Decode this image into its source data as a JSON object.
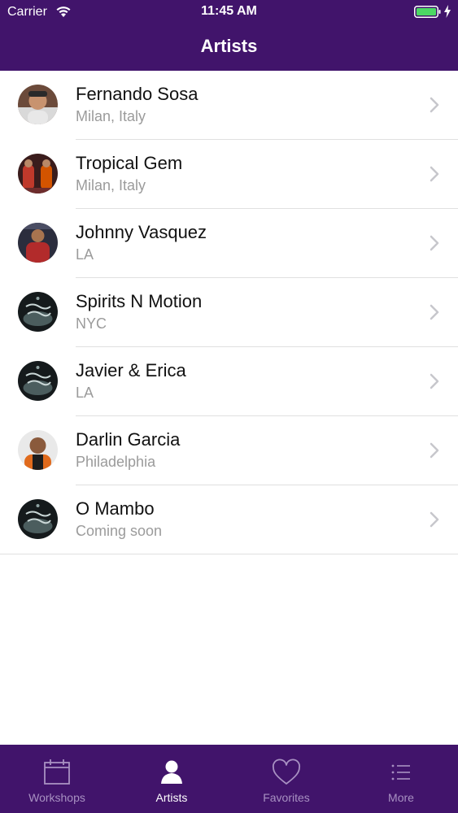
{
  "status_bar": {
    "carrier": "Carrier",
    "time": "11:45 AM"
  },
  "nav": {
    "title": "Artists"
  },
  "artists": [
    {
      "name": "Fernando Sosa",
      "location": "Milan, Italy",
      "avatar": "photo"
    },
    {
      "name": "Tropical Gem",
      "location": "Milan, Italy",
      "avatar": "photo"
    },
    {
      "name": "Johnny Vasquez",
      "location": "LA",
      "avatar": "photo"
    },
    {
      "name": "Spirits N Motion",
      "location": "NYC",
      "avatar": "coming-soon"
    },
    {
      "name": "Javier & Erica",
      "location": "LA",
      "avatar": "coming-soon"
    },
    {
      "name": "Darlin Garcia",
      "location": "Philadelphia",
      "avatar": "photo"
    },
    {
      "name": "O Mambo",
      "location": "Coming soon",
      "avatar": "coming-soon"
    }
  ],
  "tabs": [
    {
      "label": "Workshops",
      "icon": "calendar-icon",
      "active": false
    },
    {
      "label": "Artists",
      "icon": "person-icon",
      "active": true
    },
    {
      "label": "Favorites",
      "icon": "heart-icon",
      "active": false
    },
    {
      "label": "More",
      "icon": "list-icon",
      "active": false
    }
  ],
  "colors": {
    "brand": "#41146b",
    "tab_inactive": "#a891c2",
    "subtitle": "#9b9b9b",
    "battery": "#4cd964"
  }
}
